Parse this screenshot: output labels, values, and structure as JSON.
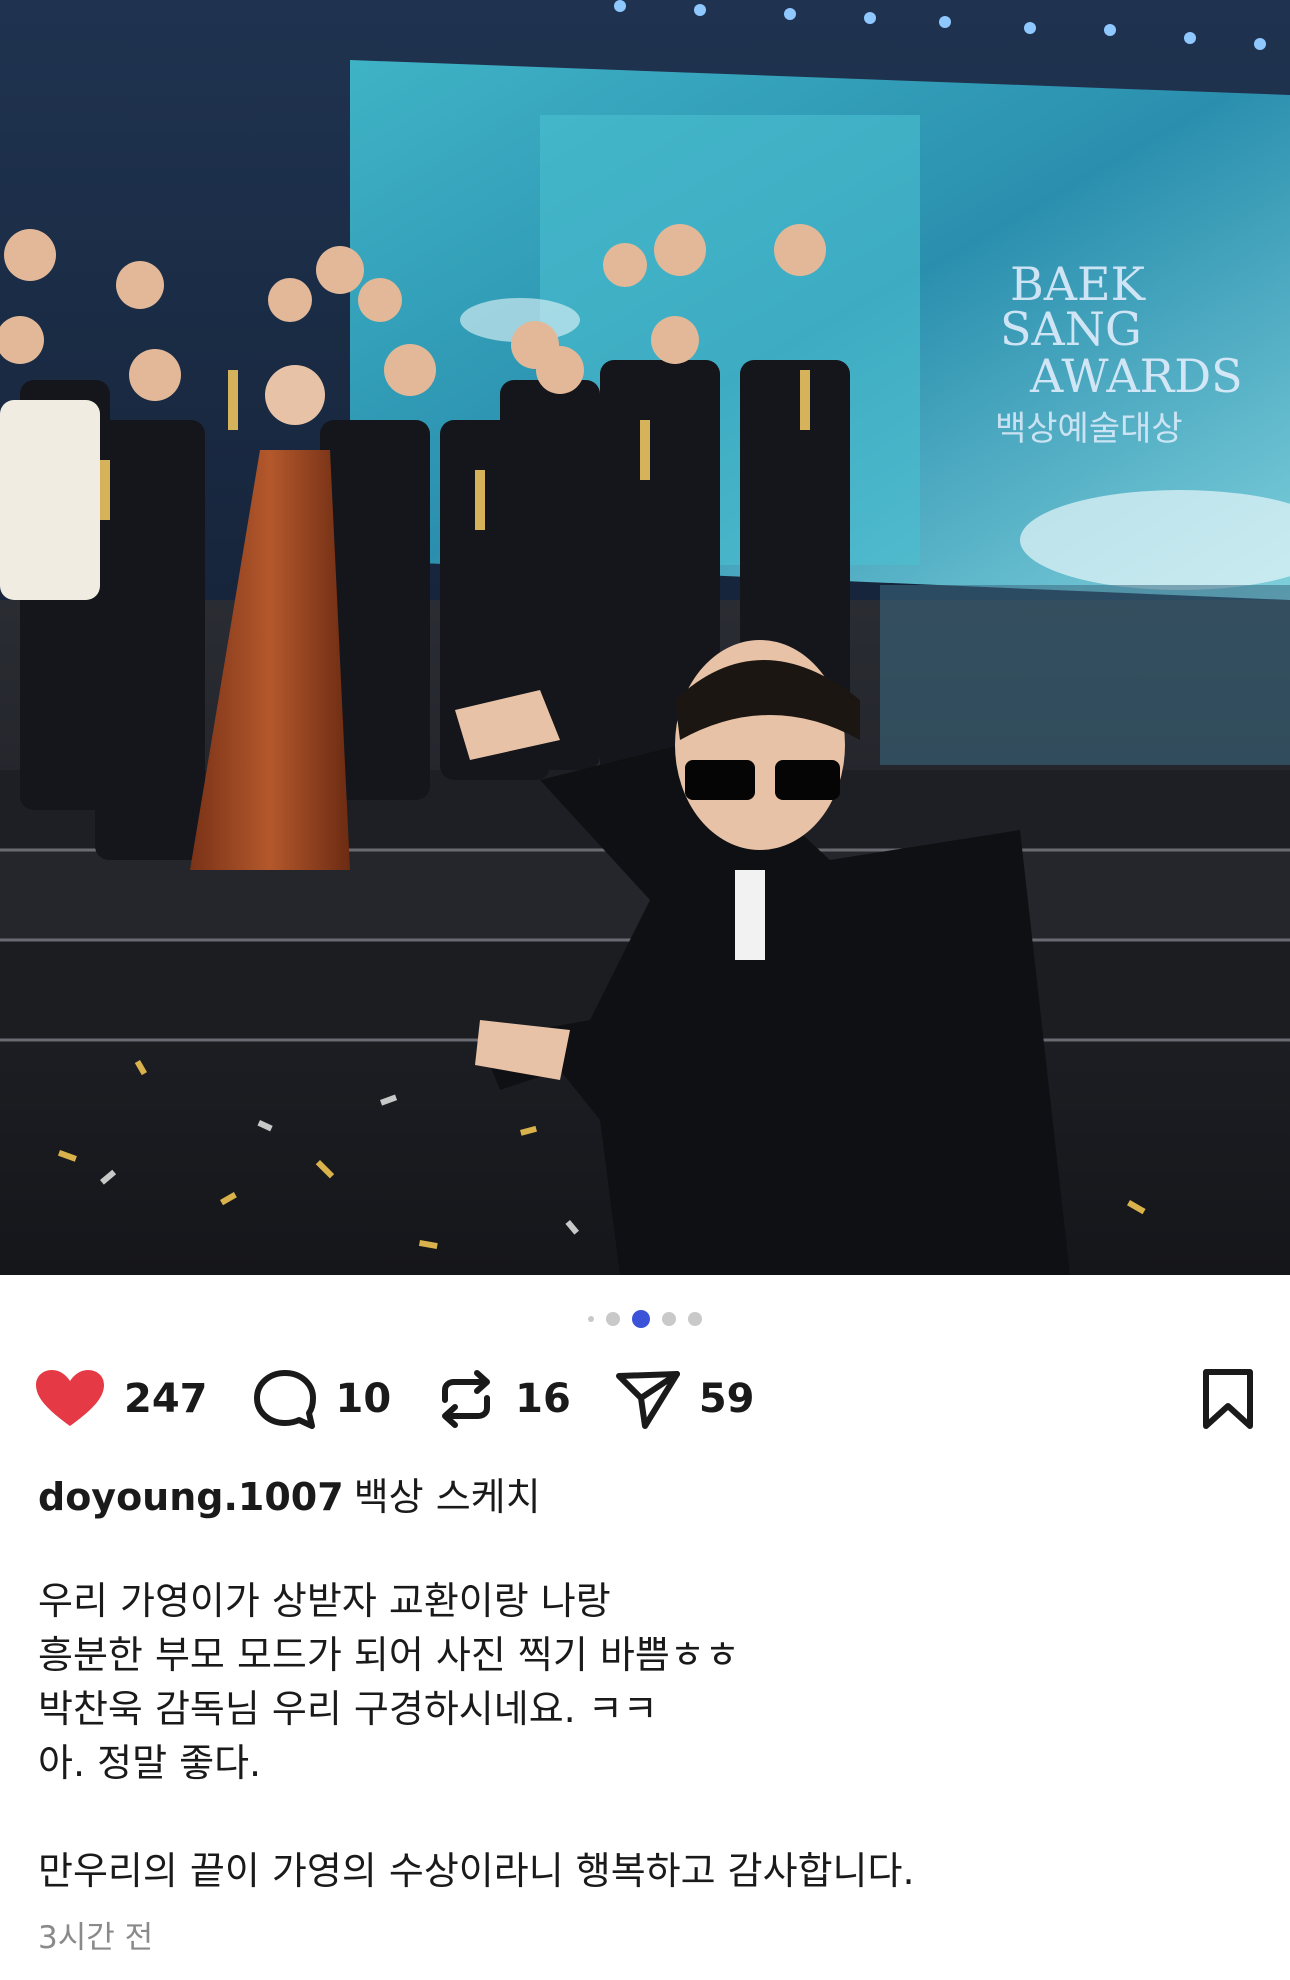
{
  "post": {
    "image": {
      "description_icon": "photo",
      "screen_text": [
        "BAEK",
        "SANG",
        "AWARDS",
        "백상예술대상"
      ]
    },
    "carousel": {
      "count": 5,
      "active_index": 2
    },
    "actions": {
      "like_count": "247",
      "comment_count": "10",
      "repost_count": "16",
      "share_count": "59"
    },
    "colors": {
      "like": "#e63946",
      "active_dot": "#3a53d8",
      "muted": "#8a8a8a"
    },
    "caption": {
      "username": "doyoung.1007",
      "title": "백상 스케치",
      "lines": [
        "우리 가영이가 상받자 교환이랑 나랑",
        "흥분한 부모 모드가 되어 사진 찍기 바쁨ㅎㅎ",
        "박찬욱 감독님 우리 구경하시네요. ㅋㅋ",
        "아. 정말 좋다."
      ],
      "closing_line": "만우리의 끝이 가영의 수상이라니 행복하고 감사합니다."
    },
    "timestamp": "3시간 전"
  }
}
